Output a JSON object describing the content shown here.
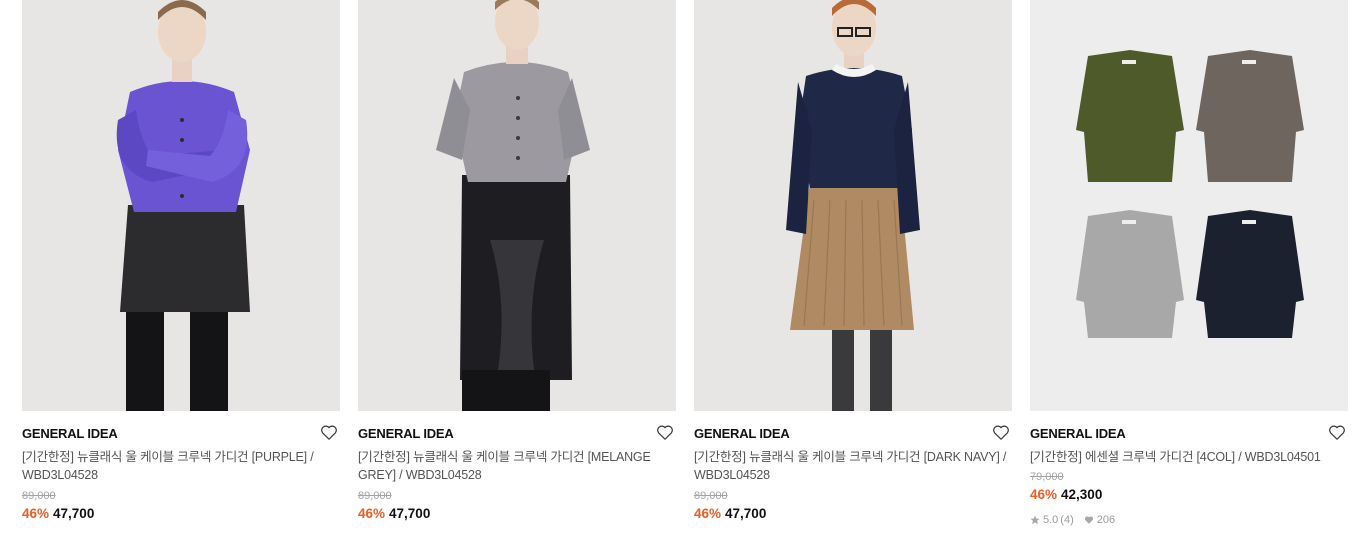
{
  "products": [
    {
      "brand": "GENERAL IDEA",
      "title": "[기간한정] 뉴클래식 울 케이블 크루넥 가디건 [PURPLE] / WBD3L04528",
      "original_price": "89,000",
      "discount": "46%",
      "price": "47,700",
      "image": "purple cable cardigan with black skirt",
      "colors": {
        "top": "#6a54d2",
        "bottom": "#2c2c2e"
      }
    },
    {
      "brand": "GENERAL IDEA",
      "title": "[기간한정] 뉴클래식 울 케이블 크루넥 가디건 [MELANGE GREY] / WBD3L04528",
      "original_price": "89,000",
      "discount": "46%",
      "price": "47,700",
      "image": "grey cable cardigan with black lace skirt",
      "colors": {
        "top": "#9c9aa0",
        "bottom": "#1e1e22"
      }
    },
    {
      "brand": "GENERAL IDEA",
      "title": "[기간한정] 뉴클래식 울 케이블 크루넥 가디건 [DARK NAVY] / WBD3L04528",
      "original_price": "89,000",
      "discount": "46%",
      "price": "47,700",
      "image": "navy cable cardigan with camel pleated skirt",
      "colors": {
        "top": "#1f2846",
        "bottom": "#b08a62"
      }
    },
    {
      "brand": "GENERAL IDEA",
      "title": "[기간한정] 에센셜 크루넥 가디건 [4COL] / WBD3L04501",
      "original_price": "79,000",
      "discount": "46%",
      "price": "42,300",
      "image": "four crewneck cardigans flat lay",
      "colors": {
        "khaki": "#4e5a2a",
        "brown": "#6e655f",
        "grey": "#a8a8a8",
        "navy": "#1c2130"
      },
      "rating": "5.0",
      "review_count": "(4)",
      "likes": "206"
    }
  ],
  "icons": {
    "wishlist": "heart-outline-icon",
    "rating": "star-icon",
    "likes": "heart-filled-icon"
  },
  "accent_color": "#f05b23"
}
